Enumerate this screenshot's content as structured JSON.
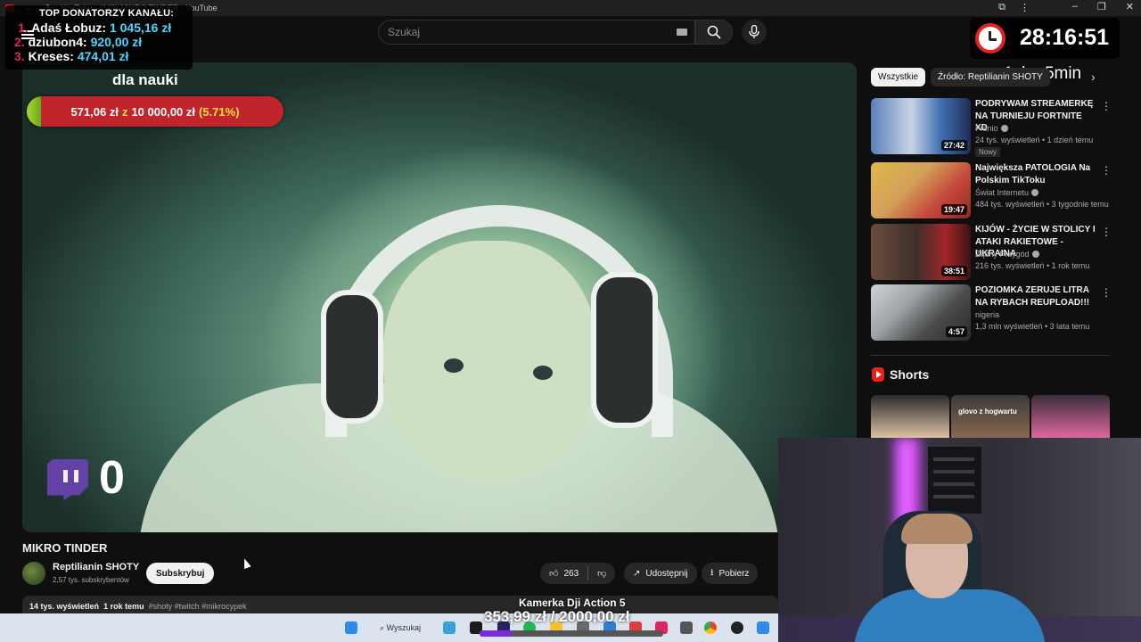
{
  "browser": {
    "tab_title": "YouTube - (149) MIKRO TINDER - YouTube"
  },
  "masthead": {
    "search_placeholder": "Szukaj"
  },
  "overlay": {
    "donors": {
      "header": "TOP DONATORZY KANAŁU:",
      "list": [
        {
          "rank": "1.",
          "name": "Adaś Łobuz:",
          "amount": "1 045,16 zł"
        },
        {
          "rank": "2.",
          "name": "dziubon4:",
          "amount": "920,00 zł"
        },
        {
          "rank": "3.",
          "name": "Kreses:",
          "amount": "474,01 zł"
        }
      ]
    },
    "goal": {
      "title": "dla nauki",
      "current": "571,06 zł",
      "of": "z",
      "target": "10 000,00 zł",
      "percent": "(5.71%)",
      "fraction": 0.0571
    },
    "timer": "28:16:51",
    "rate": "1zł = 5min",
    "viewer_count": "0",
    "camera_goal": {
      "label": "Kamerka Dji Action 5",
      "text": "353,99 zł / 2000,00 zł",
      "fraction": 0.177
    }
  },
  "video": {
    "title": "MIKRO TINDER",
    "channel": "Reptilianin SHOTY",
    "subscribers": "2,57 tys. subskrybentów",
    "subscribe_label": "Subskrybuj",
    "likes": "263",
    "share_label": "Udostępnij",
    "download_label": "Pobierz",
    "views": "14 tys. wyświetleń",
    "age": "1 rok temu",
    "tags": "#shoty #twitch #mikrocypek"
  },
  "chips": [
    "Wszystkie",
    "Źródło: Reptilianin SHOTY"
  ],
  "recommendations": [
    {
      "title": "PODRYWAM STREAMERKĘ NA TURNIEJU FORTNITE XD",
      "channel": "Franio",
      "meta": "24 tys. wyświetleń • 1 dzień temu",
      "badge": "Nowy",
      "duration": "27:42"
    },
    {
      "title": "Największa PATOLOGIA Na Polskim TikToku",
      "channel": "Świat Internetu",
      "meta": "484 tys. wyświetleń • 3 tygodnie temu",
      "duration": "19:47"
    },
    {
      "title": "KIJÓW - ŻYCIE W STOLICY I ATAKI RAKIETOWE - UKRAINA",
      "channel": "Żądny Przygód",
      "meta": "216 tys. wyświetleń • 1 rok temu",
      "duration": "38:51"
    },
    {
      "title": "POZIOMKA ZERUJE LITRA NA RYBACH REUPLOAD!!!",
      "channel": "nigeria",
      "meta": "1,3 mln wyświetleń • 3 lata temu",
      "duration": "4:57"
    }
  ],
  "shorts": {
    "heading": "Shorts",
    "items": [
      {
        "label": ""
      },
      {
        "label": "glovo z hogwartu"
      },
      {
        "label": ""
      }
    ]
  },
  "taskbar": {
    "search_label": "Wyszukaj"
  }
}
